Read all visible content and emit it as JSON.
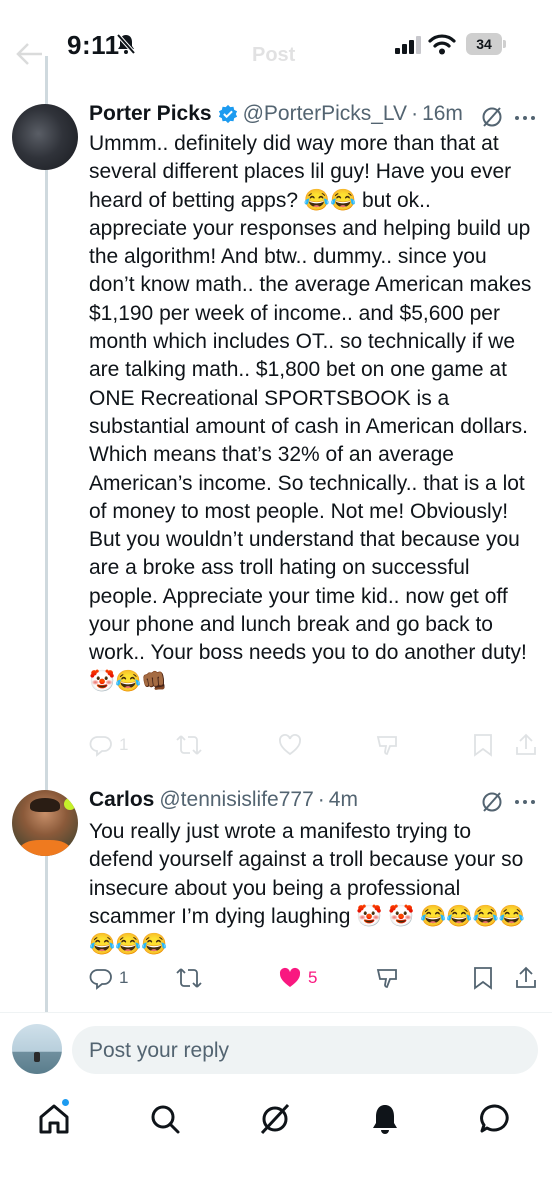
{
  "status_bar": {
    "time": "9:11",
    "battery": "34"
  },
  "header": {
    "title": "Post"
  },
  "tweets": [
    {
      "name": "Porter Picks",
      "handle": "@PorterPicks_LV",
      "time": "16m",
      "text": "Ummm.. definitely did way more than that at several different places lil guy! Have you ever heard of betting apps? 😂😂 but ok.. appreciate your responses and helping build up the algorithm! And btw.. dummy.. since you don’t know math.. the average American makes $1,190 per week of income.. and $5,600 per month which includes OT.. so technically if we are talking math.. $1,800 bet on one game at ONE Recreational SPORTSBOOK is a substantial amount of cash in American dollars. Which means that’s 32% of an average American’s income. So technically.. that is a lot of money to most people. Not me! Obviously! But you wouldn’t understand that because you are a broke ass troll hating on successful people. Appreciate your time kid.. now get off your phone and lunch break and go back to work.. Your boss needs you to do another duty! 🤡😂👊🏾",
      "replies": "1",
      "likes": ""
    },
    {
      "name": "Carlos",
      "handle": "@tennisislife777",
      "time": "4m",
      "text": "You really just wrote a manifesto trying to defend yourself against a troll because your so insecure about you being a professional scammer I’m dying laughing 🤡 🤡 😂😂😂😂😂😂😂",
      "replies": "1",
      "likes": "5"
    }
  ],
  "reply": {
    "placeholder": "Post your reply"
  },
  "colors": {
    "accent": "#1d9bf0",
    "like": "#f91880",
    "secondary_text": "#536471"
  },
  "nav": [
    "home-icon",
    "search-icon",
    "grok-icon",
    "notifications-icon",
    "messages-icon"
  ]
}
